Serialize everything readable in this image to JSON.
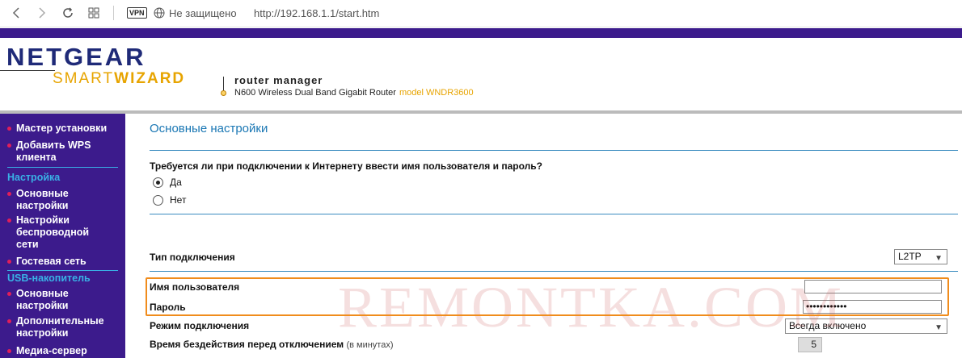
{
  "browser": {
    "vpn_label": "VPN",
    "security_text": "Не защищено",
    "url": "http://192.168.1.1/start.htm"
  },
  "header": {
    "brand_name": "NETGEAR",
    "brand_smart": "SMART",
    "brand_wizard": "WIZARD",
    "router_manager": "router manager",
    "router_desc": "N600 Wireless Dual Band Gigabit Router",
    "model": "model WNDR3600"
  },
  "sidebar": {
    "items_top": [
      {
        "label": "Мастер установки"
      },
      {
        "label": "Добавить WPS клиента"
      }
    ],
    "section_setup": "Настройка",
    "items_setup": [
      {
        "label": "Основные настройки"
      },
      {
        "label": "Настройки беспроводной сети"
      },
      {
        "label": "Гостевая сеть"
      }
    ],
    "section_usb": "USB-накопитель",
    "items_usb": [
      {
        "label": "Основные настройки"
      },
      {
        "label": "Дополнительные настройки"
      },
      {
        "label": "Медиа-сервер"
      }
    ]
  },
  "main": {
    "title": "Основные настройки",
    "question": "Требуется ли при подключении к Интернету ввести имя пользователя и пароль?",
    "radio_yes": "Да",
    "radio_no": "Нет",
    "connection_type_label": "Тип подключения",
    "connection_type_value": "L2TP",
    "username_label": "Имя пользователя",
    "username_value": "",
    "password_label": "Пароль",
    "password_value": "••••••••••••",
    "mode_label": "Режим подключения",
    "mode_value": "Всегда включено",
    "idle_label": "Время бездействия перед отключением",
    "idle_unit": "(в минутах)",
    "idle_value": "5"
  },
  "watermark": "REMONTKA.COM",
  "colors": {
    "purple": "#3c1b8c",
    "accent_blue": "#1a77b4",
    "accent_orange": "#f08c1c",
    "brand_gold": "#e7a400"
  }
}
